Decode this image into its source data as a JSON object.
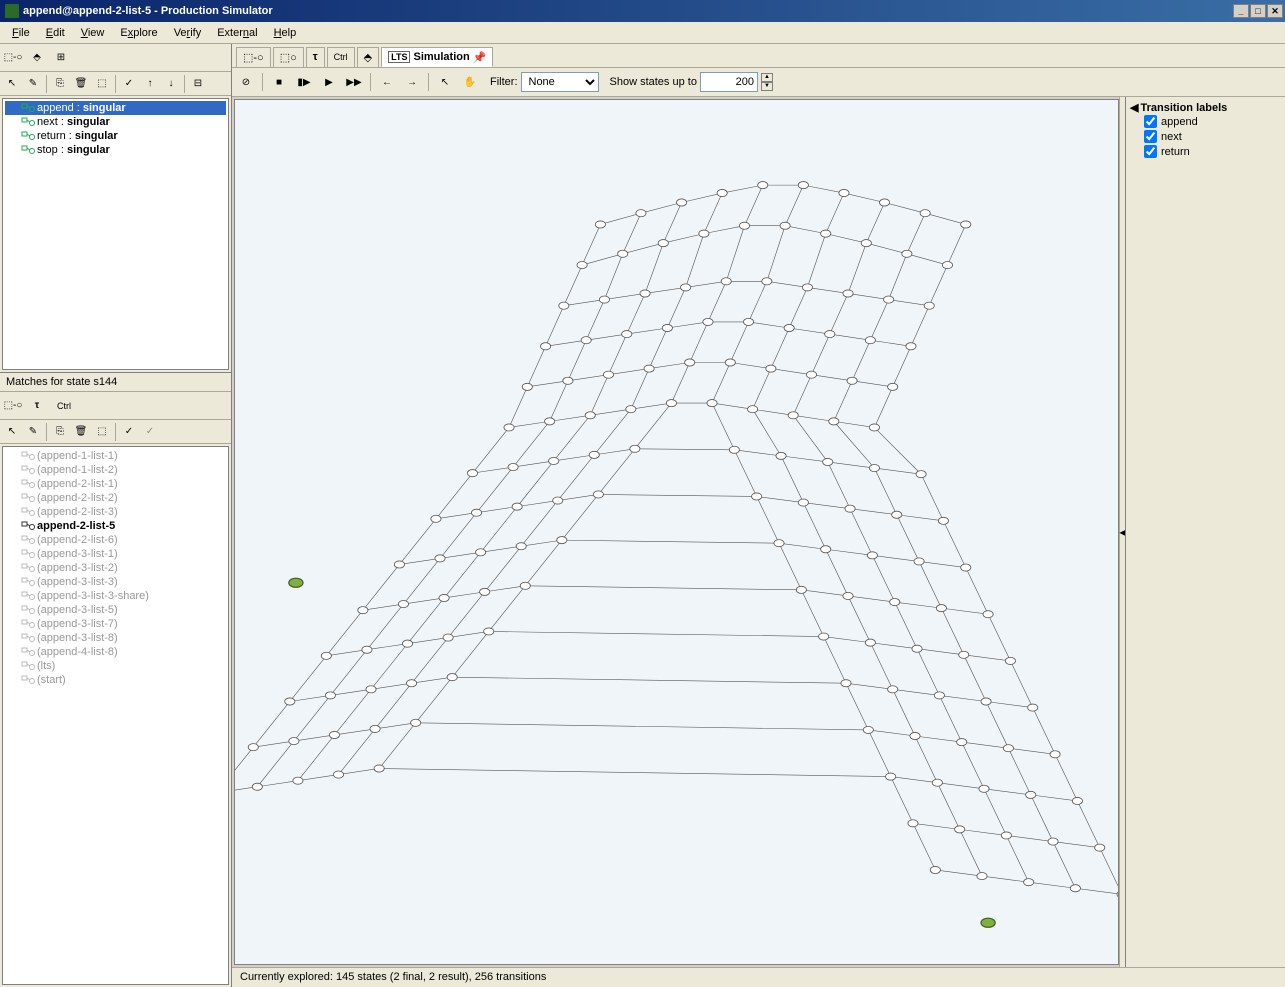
{
  "window": {
    "title": "append@append-2-list-5 - Production Simulator"
  },
  "menubar": [
    "File",
    "Edit",
    "View",
    "Explore",
    "Verify",
    "External",
    "Help"
  ],
  "top_tree": [
    {
      "name": "append",
      "kind": "singular",
      "selected": true
    },
    {
      "name": "next",
      "kind": "singular",
      "selected": false
    },
    {
      "name": "return",
      "kind": "singular",
      "selected": false
    },
    {
      "name": "stop",
      "kind": "singular",
      "selected": false
    }
  ],
  "matches_label": "Matches for state s144",
  "bottom_tree": [
    {
      "label": "(append-1-list-1)",
      "gray": true
    },
    {
      "label": "(append-1-list-2)",
      "gray": true
    },
    {
      "label": "(append-2-list-1)",
      "gray": true
    },
    {
      "label": "(append-2-list-2)",
      "gray": true
    },
    {
      "label": "(append-2-list-3)",
      "gray": true
    },
    {
      "label": "append-2-list-5",
      "gray": false,
      "selected": true
    },
    {
      "label": "(append-2-list-6)",
      "gray": true
    },
    {
      "label": "(append-3-list-1)",
      "gray": true
    },
    {
      "label": "(append-3-list-2)",
      "gray": true
    },
    {
      "label": "(append-3-list-3)",
      "gray": true
    },
    {
      "label": "(append-3-list-3-share)",
      "gray": true
    },
    {
      "label": "(append-3-list-5)",
      "gray": true
    },
    {
      "label": "(append-3-list-7)",
      "gray": true
    },
    {
      "label": "(append-3-list-8)",
      "gray": true
    },
    {
      "label": "(append-4-list-8)",
      "gray": true
    },
    {
      "label": "(lts)",
      "gray": true
    },
    {
      "label": "(start)",
      "gray": true
    }
  ],
  "tabs": {
    "lts": "LTS",
    "simulation": "Simulation"
  },
  "filter": {
    "label": "Filter:",
    "value": "None",
    "states_label": "Show states up to",
    "states_value": "200"
  },
  "transition_panel": {
    "title": "Transition labels",
    "items": [
      {
        "label": "append",
        "checked": true
      },
      {
        "label": "next",
        "checked": true
      },
      {
        "label": "return",
        "checked": true
      }
    ]
  },
  "statusbar": "Currently explored: 145 states (2 final, 2 result), 256 transitions"
}
